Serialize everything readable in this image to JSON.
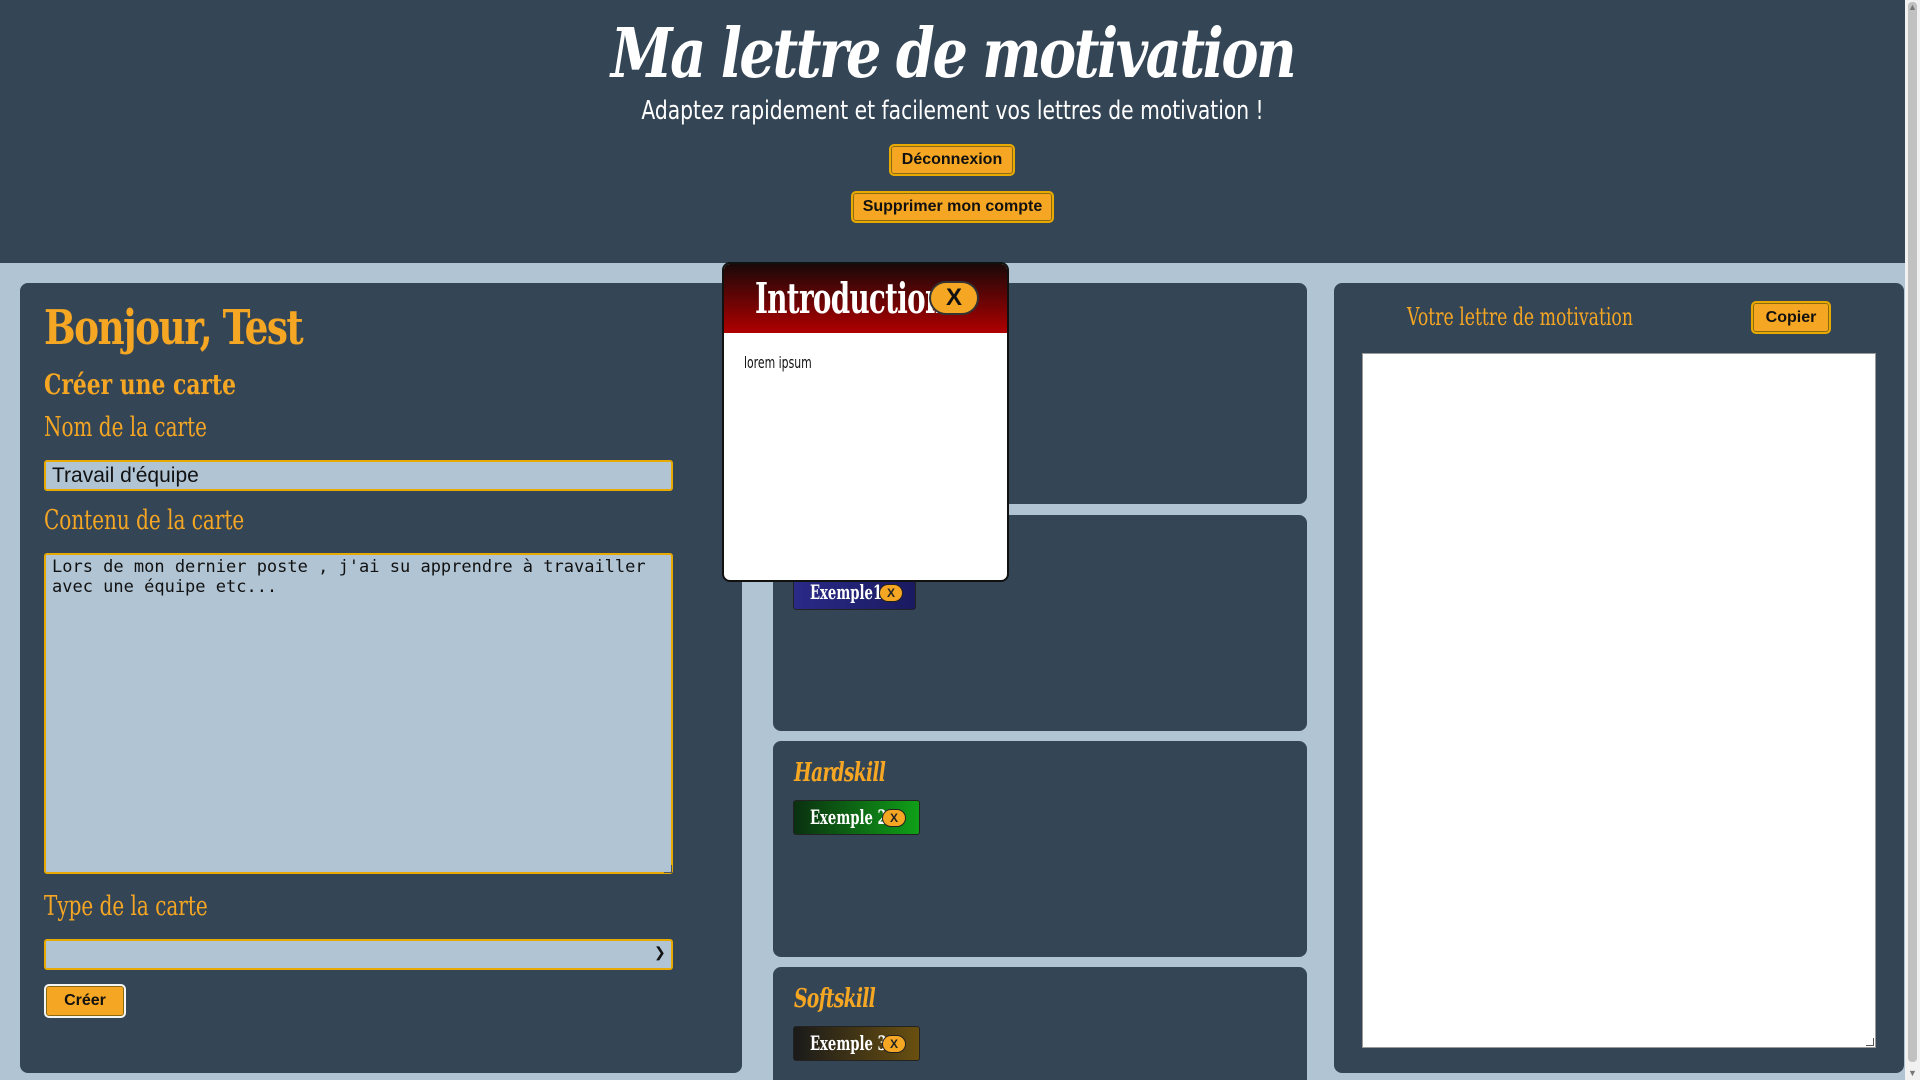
{
  "header": {
    "title": "Ma lettre de motivation",
    "subtitle": "Adaptez rapidement et facilement vos lettres de motivation !",
    "logout_label": "Déconnexion",
    "delete_account_label": "Supprimer mon compte"
  },
  "create_panel": {
    "greeting": "Bonjour, Test",
    "section_title": "Créer une carte",
    "name_label": "Nom de la carte",
    "name_value": "Travail d'équipe",
    "content_label": "Contenu de la carte",
    "content_value": "Lors de mon dernier poste , j'ai su apprendre à travailler\navec une équipe etc...",
    "type_label": "Type de la carte",
    "type_value": "",
    "create_label": "Créer"
  },
  "categories": [
    {
      "title": "",
      "cards": [
        {
          "label": "Exemple1",
          "remove": "X"
        }
      ]
    },
    {
      "title": "Hardskill",
      "cards": [
        {
          "label": "Exemple 2",
          "remove": "X"
        }
      ]
    },
    {
      "title": "Softskill",
      "cards": [
        {
          "label": "Exemple 3",
          "remove": "X"
        }
      ]
    }
  ],
  "letter_panel": {
    "title": "Votre lettre de motivation",
    "copy_label": "Copier",
    "content": ""
  },
  "modal": {
    "title": "Introduction",
    "close_label": "X",
    "body": "lorem ipsum"
  },
  "colors": {
    "background": "#b0c4d4",
    "panel": "#344556",
    "accent": "#f5a623",
    "modal_header": "#b00000"
  },
  "icons": {
    "select_chevron": "chevron-down-icon"
  }
}
